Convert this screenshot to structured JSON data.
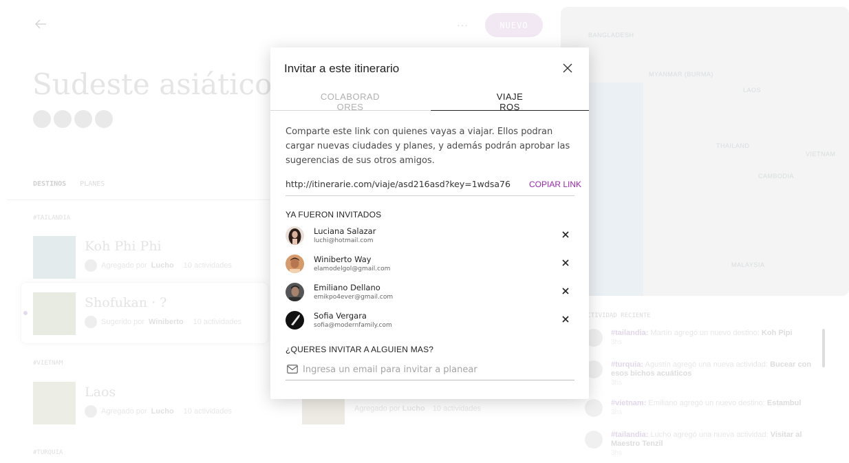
{
  "header": {
    "more_label": "···",
    "nuevo_label": "NUEVO"
  },
  "trip": {
    "title": "Sudeste asiático c"
  },
  "tabs": {
    "destinos": "DESTINOS",
    "planes": "PLANES"
  },
  "regions": [
    {
      "label": "#TAILANDIA",
      "destinations": [
        {
          "name": "Koh Phi Phi",
          "meta_prefix": "Agregado por",
          "meta_user": "Lucho",
          "meta_count": "10 actividades"
        },
        {
          "name": "Shofukan · ?",
          "meta_prefix": "Sugerido por",
          "meta_user": "Winiberto",
          "meta_count": "10 actividades"
        }
      ]
    },
    {
      "label": "#VIETNAM",
      "destinations": [
        {
          "name": "Laos",
          "meta_prefix": "Agregado por",
          "meta_user": "Lucho",
          "meta_count": "10 actividades"
        }
      ]
    },
    {
      "label": "#TURQUIA",
      "destinations": []
    }
  ],
  "ghost_meta": {
    "prefix": "Agregado por",
    "user": "Lucho",
    "count": "10 actividades"
  },
  "map": {
    "labels": [
      "BANGLADESH",
      "MYANMAR (BURMA)",
      "LAOS",
      "THAILAND",
      "VIETNAM",
      "CAMBODIA",
      "MALAYSIA"
    ]
  },
  "activity": {
    "title": "ACTIVIDAD RECIENTE",
    "items": [
      {
        "tag": "#tailandia:",
        "text": "Martín agregó un nuevo destino:",
        "target": "Koh Pipi",
        "ago": "3hs"
      },
      {
        "tag": "#turquia:",
        "text": "Agustín agregó una nueva actividad:",
        "target": "Bucear con esos bichos acuáticos",
        "ago": "3hs"
      },
      {
        "tag": "#vietnam:",
        "text": "Emiliano agregó un nuevo destino:",
        "target": "Estambul",
        "ago": "3hs"
      },
      {
        "tag": "#tailandia:",
        "text": "Lucho agregó una nueva actividad:",
        "target": "Visitar al Maestro Tenzil",
        "ago": "3hs"
      }
    ]
  },
  "modal": {
    "title": "Invitar a este itinerario",
    "tab_colaboradores": "COLABORADORES",
    "tab_viajeros": "VIAJEROS",
    "description": "Comparte este link con quienes vayas a viajar. Ellos podran cargar nuevas ciudades y planes, y además podrán aprobar las sugerencias de sus otros amigos.",
    "link": "http://itinerarie.com/viaje/asd216asd?key=1wdsa76",
    "copy_label": "COPIAR LINK",
    "invited_heading": "YA FUERON INVITADOS",
    "invitees": [
      {
        "name": "Luciana Salazar",
        "email": "luchi@hotmail.com"
      },
      {
        "name": "Winiberto Way",
        "email": "elamodelgol@gmail.com"
      },
      {
        "name": "Emiliano Dellano",
        "email": "emikpo4ever@gmail.com"
      },
      {
        "name": "Sofia Vergara",
        "email": "sofia@modernfamily.com"
      }
    ],
    "invite_more_heading": "¿QUERES INVITAR A ALGUIEN MAS?",
    "email_placeholder": "Ingresa un email para invitar a planear"
  },
  "colors": {
    "accent": "#9b26b6",
    "nuevo_bg": "#efe4f3"
  }
}
